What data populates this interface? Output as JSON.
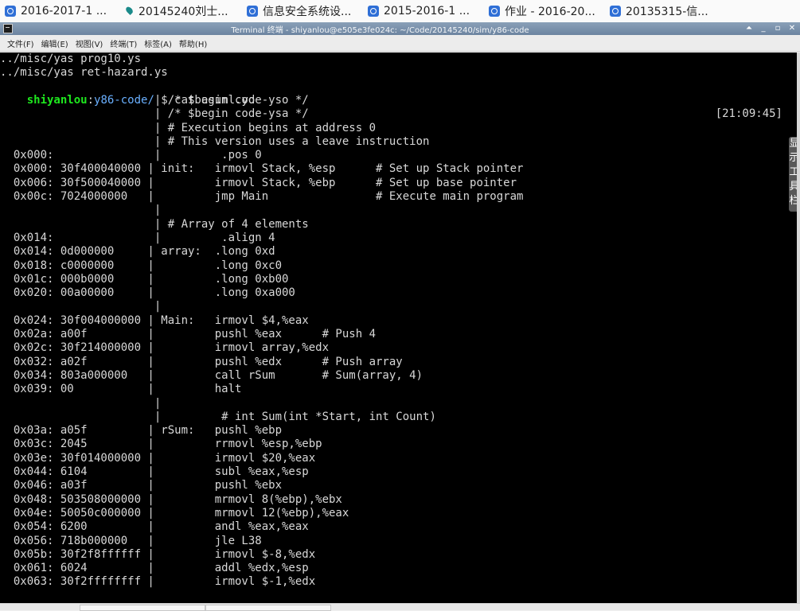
{
  "bookmarks": [
    {
      "label": "2016-2017-1 ...",
      "icon": "circle-logo-icon"
    },
    {
      "label": "20145240刘士...",
      "icon": "drop-icon"
    },
    {
      "label": "信息安全系统设...",
      "icon": "circle-logo-icon"
    },
    {
      "label": "2015-2016-1 ...",
      "icon": "circle-logo-icon"
    },
    {
      "label": "作业 - 2016-20...",
      "icon": "circle-logo-icon"
    },
    {
      "label": "20135315-信...",
      "icon": "circle-logo-icon"
    }
  ],
  "window": {
    "title": "Terminal 终端 - shiyanlou@e505e3fe024c: ~/Code/20145240/sim/y86-code",
    "controls": {
      "shade": "⏶",
      "minimize": "_",
      "maximize": "▫",
      "close": "✕"
    }
  },
  "menu": [
    "文件(F)",
    "编辑(E)",
    "视图(V)",
    "终端(T)",
    "标签(A)",
    "帮助(H)"
  ],
  "terminal": {
    "pre_lines": [
      "../misc/yas prog10.ys",
      "../misc/yas ret-hazard.ys"
    ],
    "prompt": {
      "user": "shiyanlou",
      "sep": ":",
      "path": "y86-code/",
      "symbol": " $ ",
      "command": "cat asuml.yo",
      "time": "[21:09:45]"
    },
    "output": [
      "                       | /* $begin code-yso */",
      "                       | /* $begin code-ysa */",
      "                       | # Execution begins at address 0",
      "                       | # This version uses a leave instruction",
      "  0x000:               |         .pos 0",
      "  0x000: 30f400040000 | init:   irmovl Stack, %esp      # Set up Stack pointer",
      "  0x006: 30f500040000 |         irmovl Stack, %ebp      # Set up base pointer",
      "  0x00c: 7024000000   |         jmp Main                # Execute main program",
      "                       |",
      "                       | # Array of 4 elements",
      "  0x014:               |         .align 4",
      "  0x014: 0d000000     | array:  .long 0xd",
      "  0x018: c0000000     |         .long 0xc0",
      "  0x01c: 000b0000     |         .long 0xb00",
      "  0x020: 00a00000     |         .long 0xa000",
      "                       |",
      "  0x024: 30f004000000 | Main:   irmovl $4,%eax",
      "  0x02a: a00f         |         pushl %eax      # Push 4",
      "  0x02c: 30f214000000 |         irmovl array,%edx",
      "  0x032: a02f         |         pushl %edx      # Push array",
      "  0x034: 803a000000   |         call rSum       # Sum(array, 4)",
      "  0x039: 00           |         halt",
      "                       |",
      "                       |         # int Sum(int *Start, int Count)",
      "  0x03a: a05f         | rSum:   pushl %ebp",
      "  0x03c: 2045         |         rrmovl %esp,%ebp",
      "  0x03e: 30f014000000 |         irmovl $20,%eax",
      "  0x044: 6104         |         subl %eax,%esp",
      "  0x046: a03f         |         pushl %ebx",
      "  0x048: 503508000000 |         mrmovl 8(%ebp),%ebx",
      "  0x04e: 50050c000000 |         mrmovl 12(%ebp),%eax",
      "  0x054: 6200         |         andl %eax,%eax",
      "  0x056: 718b000000   |         jle L38",
      "  0x05b: 30f2f8ffffff |         irmovl $-8,%edx",
      "  0x061: 6024         |         addl %edx,%esp",
      "  0x063: 30f2ffffffff |         irmovl $-1,%edx"
    ]
  },
  "side_panel": {
    "label_chars": [
      "显",
      "示",
      "工",
      "具",
      "栏"
    ]
  },
  "colors": {
    "terminal_bg": "#000000",
    "terminal_fg": "#d8d8d8",
    "prompt_user": "#1ee81e",
    "prompt_path": "#6ab0ff",
    "titlebar": "#7890aa"
  }
}
